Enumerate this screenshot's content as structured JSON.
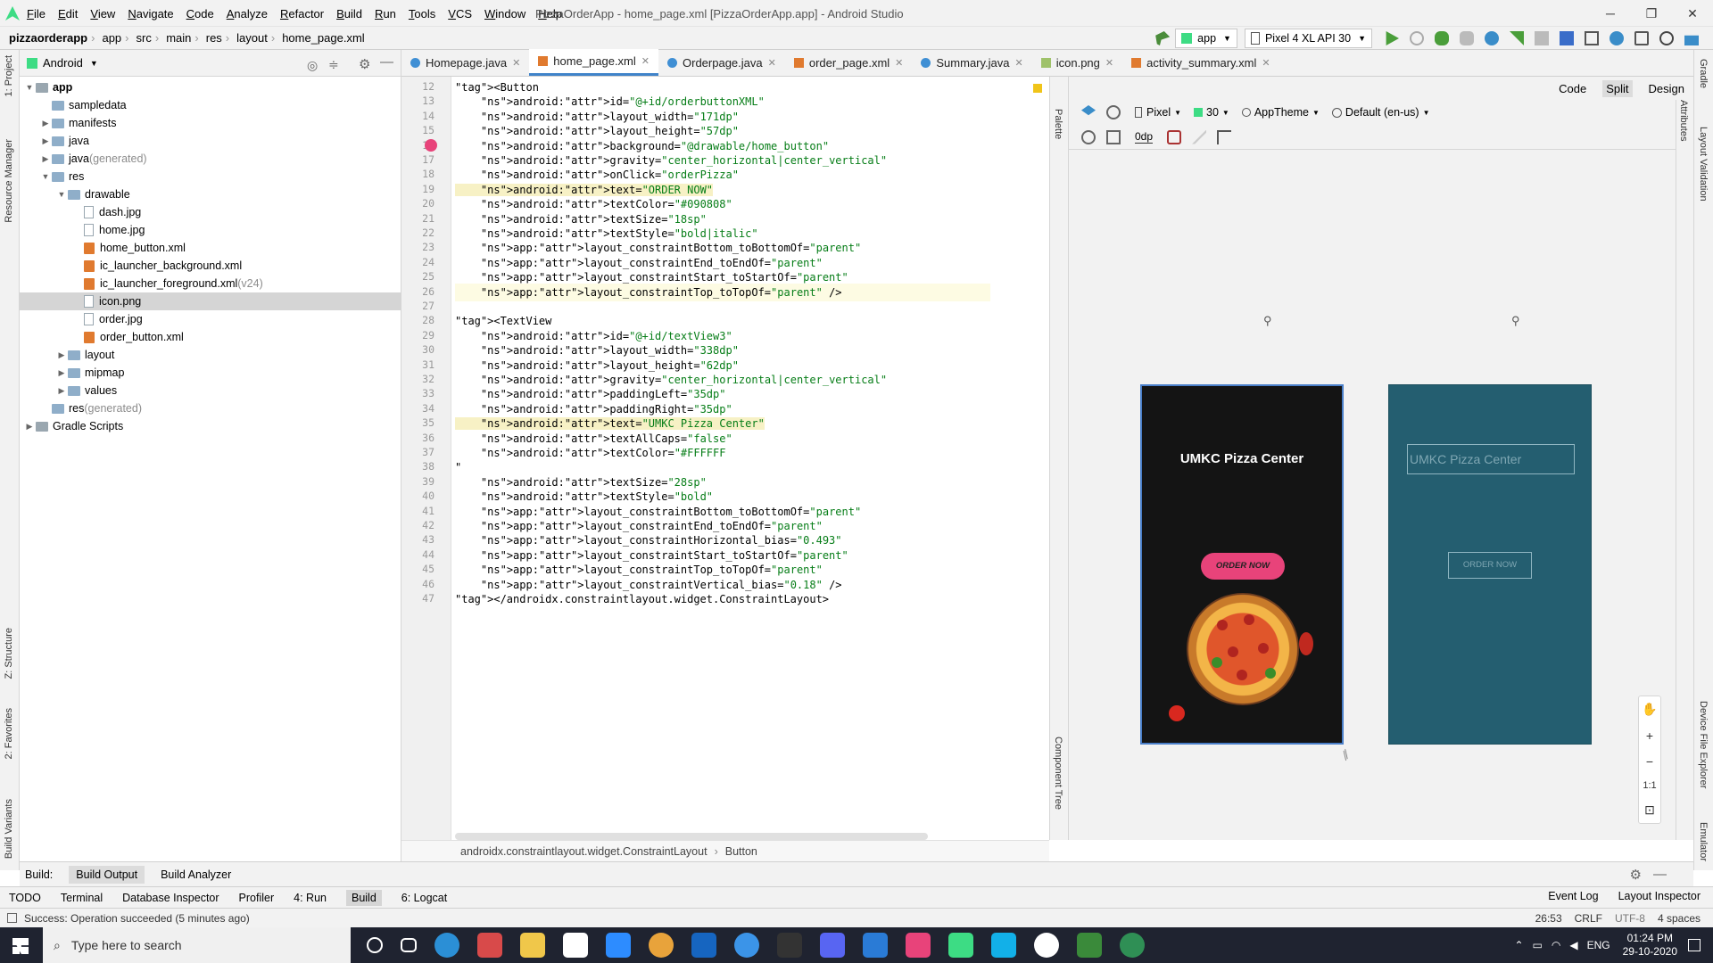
{
  "window": {
    "title": "PizzaOrderApp - home_page.xml [PizzaOrderApp.app] - Android Studio",
    "menu": [
      "File",
      "Edit",
      "View",
      "Navigate",
      "Code",
      "Analyze",
      "Refactor",
      "Build",
      "Run",
      "Tools",
      "VCS",
      "Window",
      "Help"
    ],
    "controls": {
      "minimize": "─",
      "maximize": "❐",
      "close": "✕"
    }
  },
  "breadcrumb": [
    "pizzaorderapp",
    "app",
    "src",
    "main",
    "res",
    "layout",
    "home_page.xml"
  ],
  "run_toolbar": {
    "module": "app",
    "device": "Pixel 4 XL API 30"
  },
  "project": {
    "view_mode": "Android",
    "tree": [
      {
        "label": "app",
        "indent": 0,
        "type": "folder",
        "open": true,
        "bold": true
      },
      {
        "label": "sampledata",
        "indent": 1,
        "type": "folder"
      },
      {
        "label": "manifests",
        "indent": 1,
        "type": "folder",
        "closed": true
      },
      {
        "label": "java",
        "indent": 1,
        "type": "folder",
        "closed": true
      },
      {
        "label": "java",
        "suffix": " (generated)",
        "indent": 1,
        "type": "folder",
        "closed": true
      },
      {
        "label": "res",
        "indent": 1,
        "type": "folder",
        "open": true
      },
      {
        "label": "drawable",
        "indent": 2,
        "type": "folder",
        "open": true
      },
      {
        "label": "dash.jpg",
        "indent": 3,
        "type": "file"
      },
      {
        "label": "home.jpg",
        "indent": 3,
        "type": "file"
      },
      {
        "label": "home_button.xml",
        "indent": 3,
        "type": "xml"
      },
      {
        "label": "ic_launcher_background.xml",
        "indent": 3,
        "type": "xml"
      },
      {
        "label": "ic_launcher_foreground.xml",
        "suffix": " (v24)",
        "indent": 3,
        "type": "xml"
      },
      {
        "label": "icon.png",
        "indent": 3,
        "type": "file",
        "selected": true
      },
      {
        "label": "order.jpg",
        "indent": 3,
        "type": "file"
      },
      {
        "label": "order_button.xml",
        "indent": 3,
        "type": "xml"
      },
      {
        "label": "layout",
        "indent": 2,
        "type": "folder",
        "closed": true
      },
      {
        "label": "mipmap",
        "indent": 2,
        "type": "folder",
        "closed": true
      },
      {
        "label": "values",
        "indent": 2,
        "type": "folder",
        "closed": true
      },
      {
        "label": "res",
        "suffix": " (generated)",
        "indent": 1,
        "type": "folder"
      },
      {
        "label": "Gradle Scripts",
        "indent": 0,
        "type": "folder",
        "closed": true
      }
    ]
  },
  "tabs": [
    {
      "label": "Homepage.java",
      "kind": "java"
    },
    {
      "label": "home_page.xml",
      "kind": "xml",
      "active": true
    },
    {
      "label": "Orderpage.java",
      "kind": "java"
    },
    {
      "label": "order_page.xml",
      "kind": "xml"
    },
    {
      "label": "Summary.java",
      "kind": "java"
    },
    {
      "label": "icon.png",
      "kind": "png"
    },
    {
      "label": "activity_summary.xml",
      "kind": "xml"
    }
  ],
  "code_lines": [
    {
      "n": 12,
      "t": "<Button"
    },
    {
      "n": 13,
      "t": "    android:id=\"@+id/orderbuttonXML\""
    },
    {
      "n": 14,
      "t": "    android:layout_width=\"171dp\""
    },
    {
      "n": 15,
      "t": "    android:layout_height=\"57dp\""
    },
    {
      "n": 16,
      "t": "    android:background=\"@drawable/home_button\""
    },
    {
      "n": 17,
      "t": "    android:gravity=\"center_horizontal|center_vertical\""
    },
    {
      "n": 18,
      "t": "    android:onClick=\"orderPizza\""
    },
    {
      "n": 19,
      "t": "    android:text=\"ORDER NOW\"",
      "hl": true
    },
    {
      "n": 20,
      "t": "    android:textColor=\"#090808\""
    },
    {
      "n": 21,
      "t": "    android:textSize=\"18sp\""
    },
    {
      "n": 22,
      "t": "    android:textStyle=\"bold|italic\""
    },
    {
      "n": 23,
      "t": "    app:layout_constraintBottom_toBottomOf=\"parent\""
    },
    {
      "n": 24,
      "t": "    app:layout_constraintEnd_toEndOf=\"parent\""
    },
    {
      "n": 25,
      "t": "    app:layout_constraintStart_toStartOf=\"parent\""
    },
    {
      "n": 26,
      "t": "    app:layout_constraintTop_toTopOf=\"parent\" />",
      "cur": true
    },
    {
      "n": 27,
      "t": ""
    },
    {
      "n": 28,
      "t": "<TextView"
    },
    {
      "n": 29,
      "t": "    android:id=\"@+id/textView3\""
    },
    {
      "n": 30,
      "t": "    android:layout_width=\"338dp\""
    },
    {
      "n": 31,
      "t": "    android:layout_height=\"62dp\""
    },
    {
      "n": 32,
      "t": "    android:gravity=\"center_horizontal|center_vertical\""
    },
    {
      "n": 33,
      "t": "    android:paddingLeft=\"35dp\""
    },
    {
      "n": 34,
      "t": "    android:paddingRight=\"35dp\""
    },
    {
      "n": 35,
      "t": "    android:text=\"UMKC Pizza Center\"",
      "hl": true
    },
    {
      "n": 36,
      "t": "    android:textAllCaps=\"false\""
    },
    {
      "n": 37,
      "t": "    android:textColor=\"#FFFFFF"
    },
    {
      "n": 38,
      "t": "\""
    },
    {
      "n": 39,
      "t": "    android:textSize=\"28sp\""
    },
    {
      "n": 40,
      "t": "    android:textStyle=\"bold\""
    },
    {
      "n": 41,
      "t": "    app:layout_constraintBottom_toBottomOf=\"parent\""
    },
    {
      "n": 42,
      "t": "    app:layout_constraintEnd_toEndOf=\"parent\""
    },
    {
      "n": 43,
      "t": "    app:layout_constraintHorizontal_bias=\"0.493\""
    },
    {
      "n": 44,
      "t": "    app:layout_constraintStart_toStartOf=\"parent\""
    },
    {
      "n": 45,
      "t": "    app:layout_constraintTop_toTopOf=\"parent\""
    },
    {
      "n": 46,
      "t": "    app:layout_constraintVertical_bias=\"0.18\" />"
    },
    {
      "n": 47,
      "t": "</androidx.constraintlayout.widget.ConstraintLayout>"
    }
  ],
  "editor_breadcrumb": [
    "androidx.constraintlayout.widget.ConstraintLayout",
    "Button"
  ],
  "design": {
    "view_modes": [
      "Code",
      "Split",
      "Design"
    ],
    "active_mode": "Split",
    "device": "Pixel",
    "api": "30",
    "theme": "AppTheme",
    "locale": "Default (en-us)",
    "margin": "0dp",
    "preview_title": "UMKC Pizza Center",
    "preview_button": "ORDER NOW",
    "zoom_fit": "1:1"
  },
  "side_tools": {
    "left": [
      "1: Project",
      "Resource Manager",
      "Z: Structure",
      "2: Favorites",
      "Build Variants"
    ],
    "right": [
      "Gradle",
      "Attributes",
      "Layout Validation",
      "Device File Explorer",
      "Emulator"
    ],
    "palette": "Palette",
    "component_tree": "Component Tree"
  },
  "build_bar": {
    "label": "Build:",
    "tabs": [
      "Build Output",
      "Build Analyzer"
    ]
  },
  "tool_windows": [
    "TODO",
    "Terminal",
    "Database Inspector",
    "Profiler",
    "4: Run",
    "Build",
    "6: Logcat"
  ],
  "tool_windows_right": [
    "Event Log",
    "Layout Inspector"
  ],
  "status": {
    "message": "Success: Operation succeeded (5 minutes ago)",
    "position": "26:53",
    "line_sep": "CRLF",
    "encoding": "UTF-8",
    "indent": "4 spaces"
  },
  "taskbar": {
    "search_placeholder": "Type here to search",
    "lang": "ENG",
    "time": "01:24 PM",
    "date": "29-10-2020"
  },
  "colors": {
    "accent": "#4083c9",
    "breakpoint": "#e8437a",
    "blueprint": "#245e70",
    "button": "#e8437a"
  }
}
